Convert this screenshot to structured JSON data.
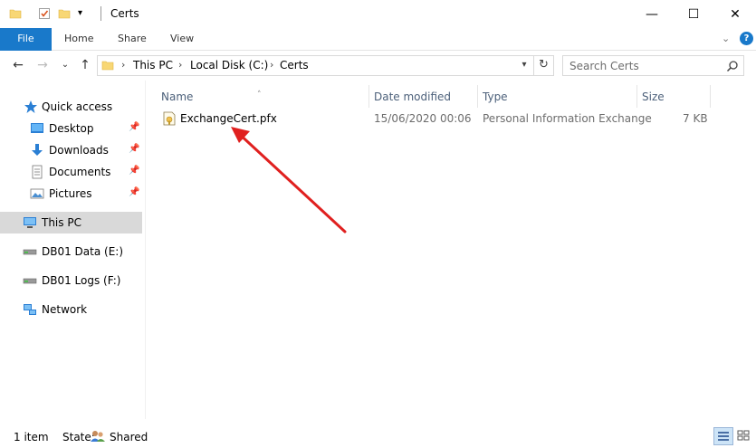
{
  "window": {
    "title": "Certs",
    "minimize_glyph": "—",
    "maximize_glyph": "☐",
    "close_glyph": "✕"
  },
  "ribbon": {
    "tabs": [
      "File",
      "Home",
      "Share",
      "View"
    ],
    "expand_glyph": "⌄"
  },
  "nav": {
    "back_glyph": "←",
    "forward_glyph": "→",
    "recent_glyph": "⌄",
    "up_glyph": "↑",
    "breadcrumb": [
      "This PC",
      "Local Disk (C:)",
      "Certs"
    ],
    "search_placeholder": "Search Certs"
  },
  "sidebar": {
    "items": [
      {
        "label": "Quick access",
        "icon": "star-icon"
      },
      {
        "label": "Desktop",
        "icon": "desktop-icon",
        "pinned": true
      },
      {
        "label": "Downloads",
        "icon": "download-icon",
        "pinned": true
      },
      {
        "label": "Documents",
        "icon": "documents-icon",
        "pinned": true
      },
      {
        "label": "Pictures",
        "icon": "pictures-icon",
        "pinned": true
      },
      {
        "label": "This PC",
        "icon": "computer-icon",
        "selected": true
      },
      {
        "label": "DB01 Data (E:)",
        "icon": "drive-icon"
      },
      {
        "label": "DB01 Logs (F:)",
        "icon": "drive-icon"
      },
      {
        "label": "Network",
        "icon": "network-icon"
      }
    ]
  },
  "table": {
    "columns": [
      "Name",
      "Date modified",
      "Type",
      "Size"
    ],
    "rows": [
      {
        "name": "ExchangeCert.pfx",
        "date": "15/06/2020 00:06",
        "type": "Personal Information Exchange",
        "size": "7 KB"
      }
    ]
  },
  "status": {
    "item_count": "1 item",
    "state_label": "State:",
    "state_value": "Shared"
  },
  "colors": {
    "accent": "#1979ca",
    "selected_bg": "#d9d9d9",
    "header_text": "#4c607a",
    "annotation_arrow": "#e0201f"
  }
}
